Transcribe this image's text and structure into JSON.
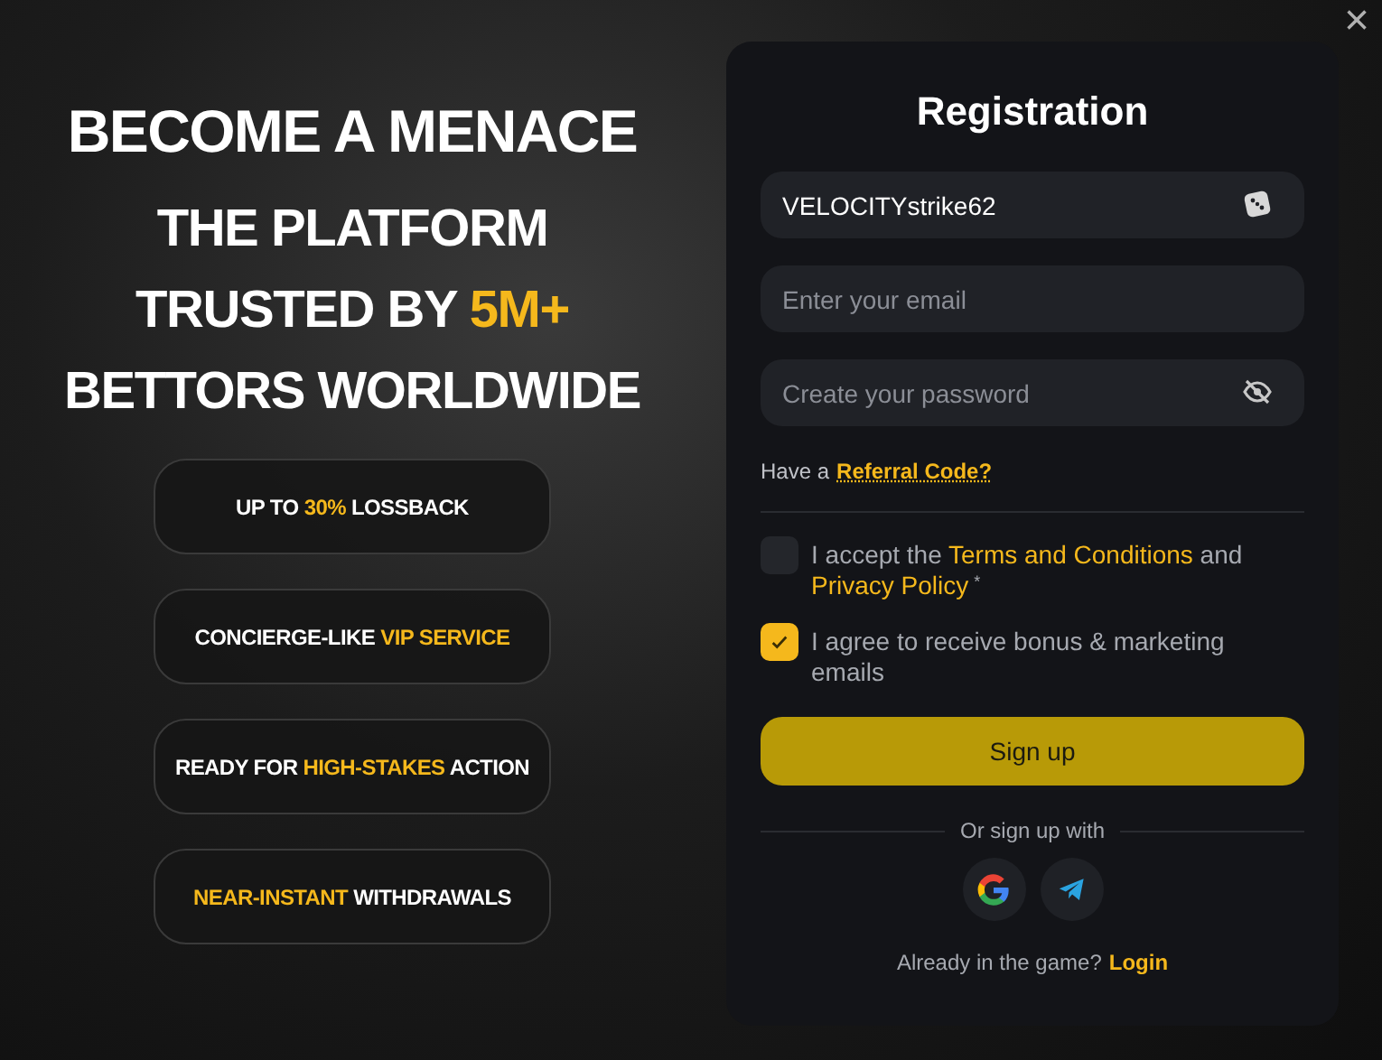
{
  "headline": "BECOME A MENACE",
  "subheadline": [
    {
      "text": "THE PLATFORM TRUSTED BY ",
      "highlight": false
    },
    {
      "text": "5M+",
      "highlight": true
    },
    {
      "text": " BETTORS WORLDWIDE",
      "highlight": false
    }
  ],
  "features": [
    [
      {
        "text": "UP TO ",
        "highlight": false
      },
      {
        "text": "30%",
        "highlight": true
      },
      {
        "text": " LOSSBACK",
        "highlight": false
      }
    ],
    [
      {
        "text": "CONCIERGE-LIKE ",
        "highlight": false
      },
      {
        "text": "VIP SERVICE",
        "highlight": true
      }
    ],
    [
      {
        "text": "READY FOR ",
        "highlight": false
      },
      {
        "text": "HIGH-STAKES",
        "highlight": true
      },
      {
        "text": " ACTION",
        "highlight": false
      }
    ],
    [
      {
        "text": "NEAR-INSTANT",
        "highlight": true
      },
      {
        "text": " WITHDRAWALS",
        "highlight": false
      }
    ]
  ],
  "form": {
    "title": "Registration",
    "fields": [
      {
        "kind": "username",
        "value": "VELOCITYstrike62"
      },
      {
        "kind": "email",
        "placeholder": "Enter your email"
      },
      {
        "kind": "password",
        "placeholder": "Create your password"
      }
    ],
    "referral": {
      "prefix": "Have a",
      "link": "Referral Code?"
    },
    "consents": [
      {
        "parts": [
          {
            "text": "I accept the ",
            "link": false
          },
          {
            "text": "Terms and Conditions",
            "link": true
          },
          {
            "text": " and ",
            "link": false
          },
          {
            "text": "Privacy Policy",
            "link": true
          }
        ],
        "required_mark": "*",
        "checked": false
      },
      {
        "parts": [
          {
            "text": "I agree to receive bonus & marketing emails",
            "link": false
          }
        ],
        "checked": true
      }
    ],
    "submit": "Sign up",
    "alt_label": "Or sign up with",
    "social": [
      {
        "kind": "google"
      },
      {
        "kind": "telegram"
      }
    ],
    "footer": {
      "text": "Already in the game?",
      "link": "Login"
    }
  },
  "close": "×"
}
